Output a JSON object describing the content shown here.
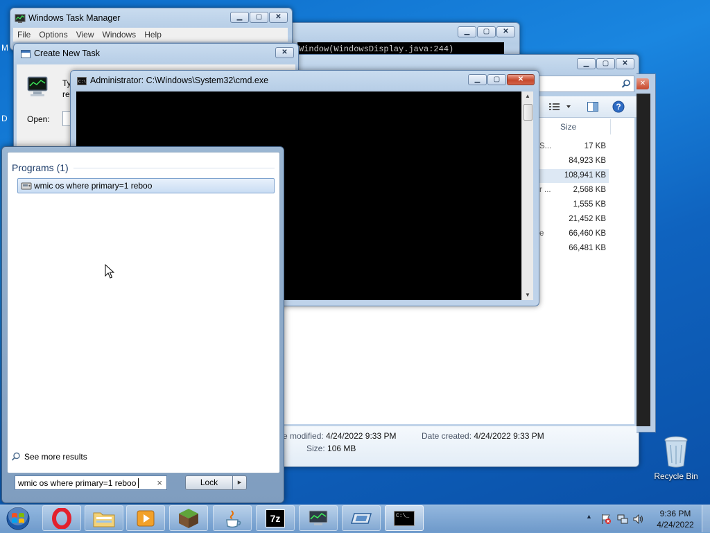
{
  "task_manager": {
    "title": "Windows Task Manager",
    "menu": [
      "File",
      "Options",
      "View",
      "Windows",
      "Help"
    ]
  },
  "java_window": {
    "text": "Window(WindowsDisplay.java:244)"
  },
  "explorer": {
    "column_size": "Size",
    "sizes": [
      "17 KB",
      "84,923 KB",
      "108,941 KB",
      "2,568 KB",
      "1,555 KB",
      "21,452 KB",
      "66,460 KB",
      "66,481 KB"
    ],
    "fragments": [
      "S...",
      "r ...",
      "e"
    ],
    "details": {
      "modified_label": "e modified:",
      "modified_value": "4/24/2022 9:33 PM",
      "created_label": "Date created:",
      "created_value": "4/24/2022 9:33 PM",
      "size_label": "Size:",
      "size_value": "106 MB"
    }
  },
  "create_task": {
    "title": "Create New Task",
    "text_fragment_1": "Ty",
    "text_fragment_2": "re",
    "open_label": "Open:"
  },
  "cmd": {
    "title": "Administrator: C:\\Windows\\System32\\cmd.exe"
  },
  "start_menu": {
    "programs_header": "Programs (1)",
    "program_item": "wmic os where primary=1 reboo",
    "see_more": "See more results",
    "search_value": "wmic os where primary=1 reboo",
    "search_clear": "×",
    "lock_label": "Lock",
    "lock_arrow": "▸"
  },
  "desktop": {
    "recycle_bin": "Recycle Bin",
    "edge_letters": [
      "M",
      "D"
    ]
  },
  "taskbar": {
    "icons": [
      "start-orb-icon",
      "opera-icon",
      "file-explorer-icon",
      "media-player-icon",
      "minecraft-icon",
      "java-icon",
      "7zip-icon",
      "task-manager-icon",
      "network-icon",
      "cmd-icon"
    ],
    "sevenzip_label": "7z",
    "cmd_label": "C:\\_",
    "time": "9:36 PM",
    "date": "4/24/2022"
  }
}
